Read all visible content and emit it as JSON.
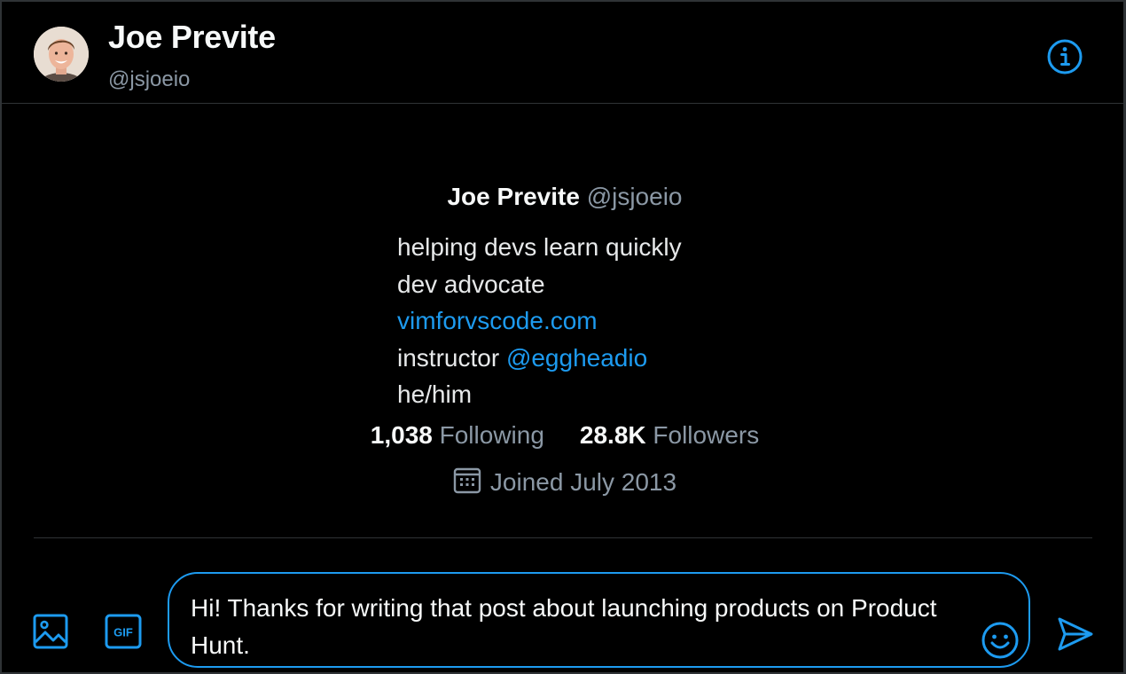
{
  "header": {
    "name": "Joe Previte",
    "handle": "@jsjoeio"
  },
  "profile": {
    "name": "Joe Previte",
    "handle": "@jsjoeio",
    "bio": {
      "line1": "helping devs learn quickly",
      "line2": "dev advocate",
      "link": "vimforvscode.com",
      "line4_prefix": "instructor ",
      "line4_mention": "@eggheadio",
      "line5": "he/him"
    },
    "following_count": "1,038",
    "following_label": "Following",
    "followers_count": "28.8K",
    "followers_label": "Followers",
    "joined": "Joined July 2013"
  },
  "composer": {
    "message": "Hi! Thanks for writing that post about launching products on Product Hunt."
  },
  "icons": {
    "info": "info-icon",
    "image": "image-icon",
    "gif": "gif-icon",
    "emoji": "emoji-icon",
    "send": "send-icon",
    "calendar": "calendar-icon"
  },
  "colors": {
    "accent": "#1d9bf0",
    "background": "#000000",
    "muted": "#8b98a5",
    "border": "#2f3336"
  }
}
